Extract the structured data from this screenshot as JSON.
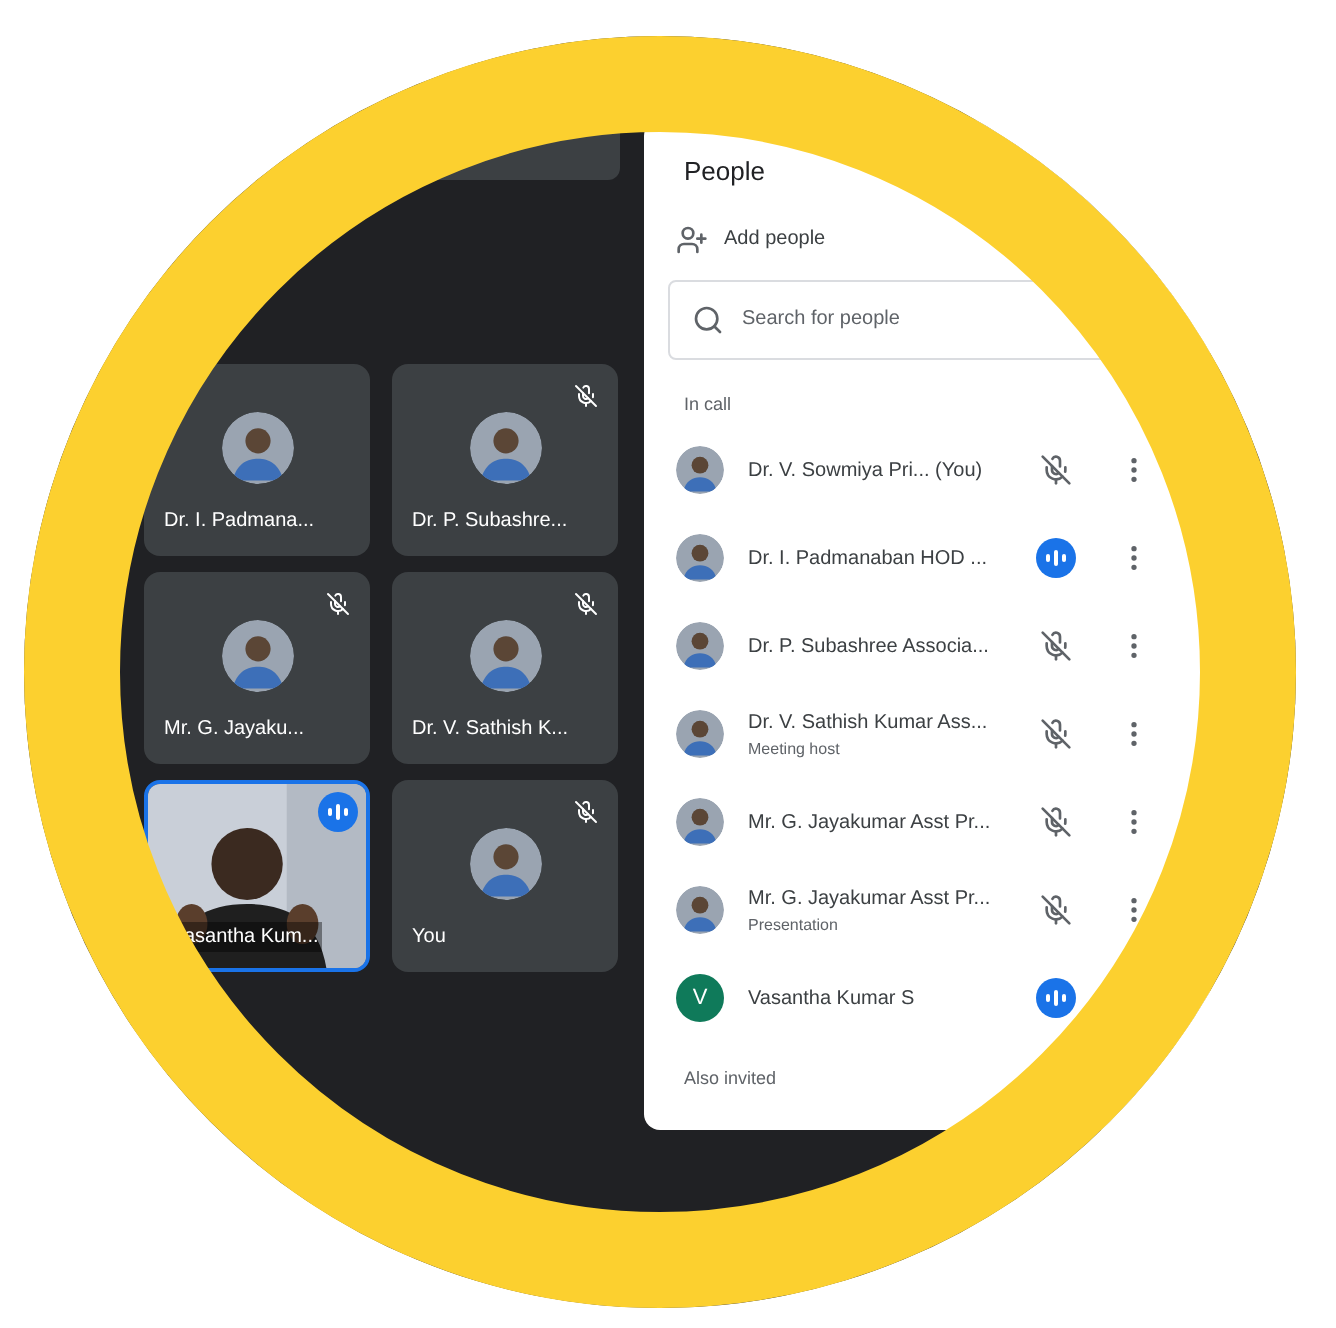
{
  "tiles": [
    {
      "name": "Dr. I. Padmana...",
      "kind": "avatar",
      "muted": false,
      "speaking": false
    },
    {
      "name": "Dr. P. Subashre...",
      "kind": "avatar",
      "muted": true,
      "speaking": false
    },
    {
      "name": "Mr. G. Jayaku...",
      "kind": "avatar",
      "muted": true,
      "speaking": false
    },
    {
      "name": "Dr. V. Sathish K...",
      "kind": "avatar",
      "muted": true,
      "speaking": false
    },
    {
      "name": "asantha Kum...",
      "kind": "video",
      "muted": false,
      "speaking": true
    },
    {
      "name": "You",
      "kind": "avatar",
      "muted": true,
      "speaking": false
    }
  ],
  "people": {
    "title": "People",
    "add_label": "Add people",
    "search": {
      "placeholder": "Search for people"
    },
    "section": "In call",
    "participants": [
      {
        "name": "Dr. V. Sowmiya Pri... (You)",
        "muted": true,
        "speaking": false,
        "menu": true
      },
      {
        "name": "Dr. I. Padmanaban HOD ...",
        "muted": false,
        "speaking": true,
        "menu": true
      },
      {
        "name": "Dr. P. Subashree Associa...",
        "muted": true,
        "speaking": false,
        "menu": true
      },
      {
        "name": "Dr. V. Sathish Kumar Ass...",
        "subtitle": "Meeting host",
        "muted": true,
        "speaking": false,
        "menu": true
      },
      {
        "name": "Mr. G. Jayakumar Asst Pr...",
        "muted": true,
        "speaking": false,
        "menu": true
      },
      {
        "name": "Mr. G. Jayakumar Asst Pr...",
        "subtitle": "Presentation",
        "muted": true,
        "speaking": false,
        "menu": true
      },
      {
        "name": "Vasantha Kumar S",
        "kind": "letter",
        "letter": "V",
        "color": "#0f7a5a",
        "muted": false,
        "speaking": true,
        "menu": false
      }
    ],
    "footer_section": "Also invited"
  }
}
